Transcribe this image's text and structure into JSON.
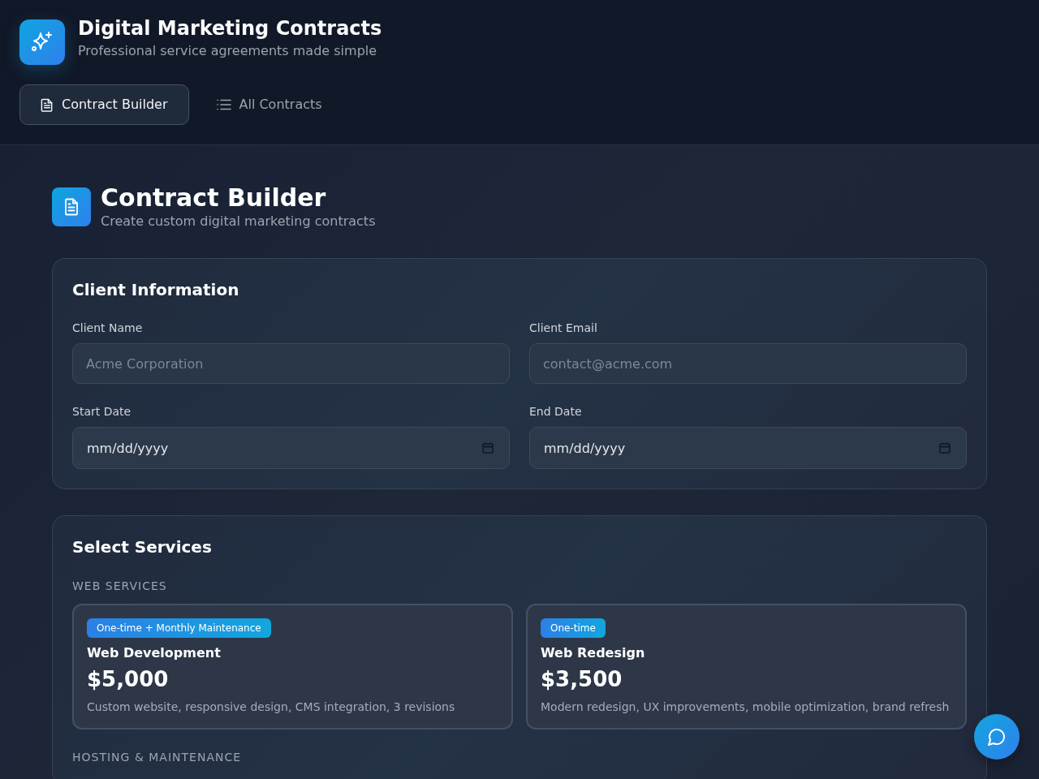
{
  "header": {
    "title": "Digital Marketing Contracts",
    "subtitle": "Professional service agreements made simple"
  },
  "tabs": [
    {
      "label": "Contract Builder",
      "selected": true
    },
    {
      "label": "All Contracts",
      "selected": false
    }
  ],
  "page": {
    "title": "Contract Builder",
    "subtitle": "Create custom digital marketing contracts"
  },
  "client_information": {
    "title": "Client Information",
    "fields": [
      {
        "kind": "text",
        "label": "Client Name",
        "placeholder": "Acme Corporation"
      },
      {
        "kind": "text",
        "label": "Client Email",
        "placeholder": "contact@acme.com"
      },
      {
        "kind": "date",
        "label": "Start Date",
        "placeholder": "mm/dd/yyyy"
      },
      {
        "kind": "date",
        "label": "End Date",
        "placeholder": "mm/dd/yyyy"
      }
    ]
  },
  "services": {
    "title": "Select Services",
    "groups": [
      {
        "heading": "WEB SERVICES",
        "items": [
          {
            "badge": "One-time + Monthly Maintenance",
            "name": "Web Development",
            "price": "$5,000",
            "description": "Custom website, responsive design, CMS integration, 3 revisions"
          },
          {
            "badge": "One-time",
            "name": "Web Redesign",
            "price": "$3,500",
            "description": "Modern redesign, UX improvements, mobile optimization, brand refresh"
          }
        ]
      },
      {
        "heading": "HOSTING & MAINTENANCE"
      }
    ]
  }
}
